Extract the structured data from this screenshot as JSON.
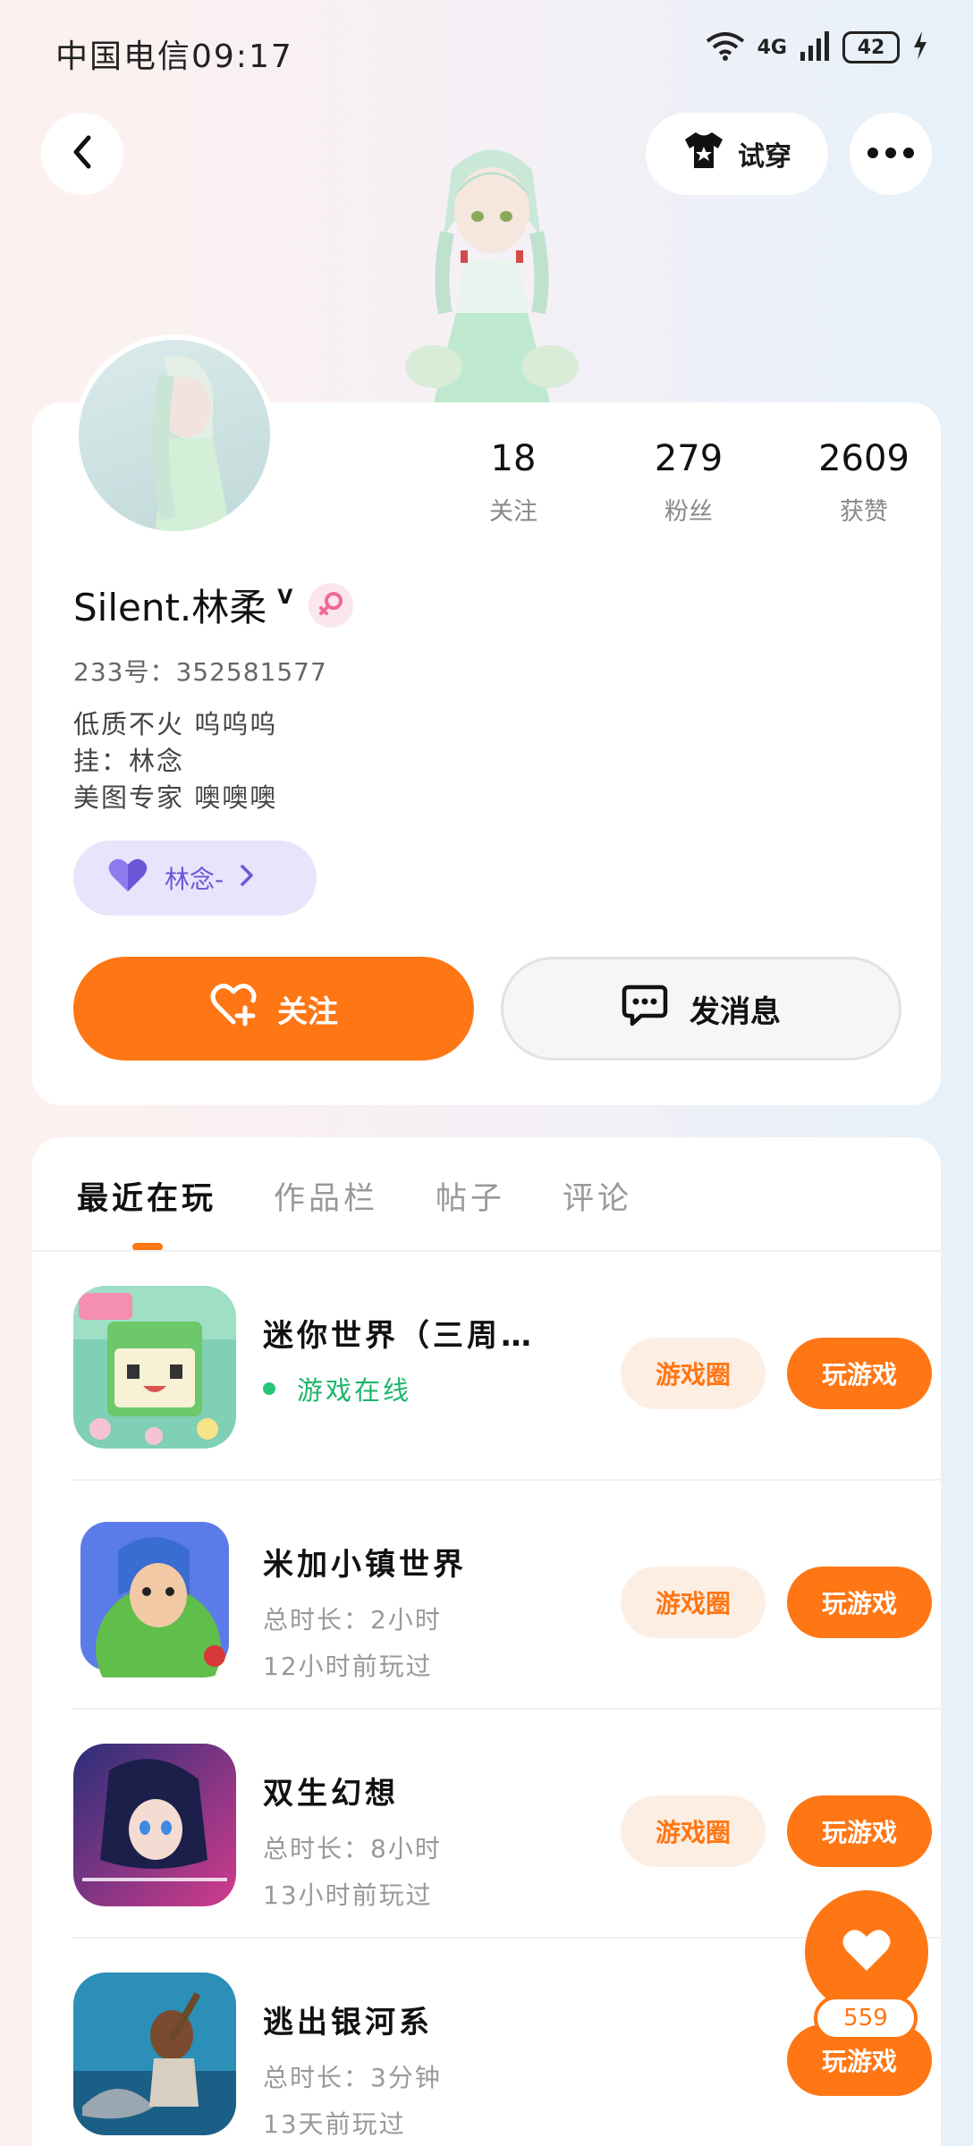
{
  "status_bar": {
    "carrier_time": "中国电信09:17",
    "network": "4G",
    "battery": "42"
  },
  "nav": {
    "tryon_label": "试穿"
  },
  "profile": {
    "stats": [
      {
        "value": "18",
        "label": "关注"
      },
      {
        "value": "279",
        "label": "粉丝"
      },
      {
        "value": "2609",
        "label": "获赞"
      }
    ],
    "username": "Silent.林柔",
    "vip_mark": "V",
    "user_id": "233号：352581577",
    "bio_lines": [
      "低质不火 呜呜呜",
      "挂：林念",
      "美图专家 噢噢噢"
    ],
    "fan_tag": "林念-",
    "follow_label": "关注",
    "message_label": "发消息"
  },
  "tabs": [
    "最近在玩",
    "作品栏",
    "帖子",
    "评论"
  ],
  "games": [
    {
      "name": "迷你世界（三周…",
      "status": "游戏在线",
      "circle_label": "游戏圈",
      "play_label": "玩游戏"
    },
    {
      "name": "米加小镇世界",
      "duration": "总时长：2小时",
      "last_played": "12小时前玩过",
      "circle_label": "游戏圈",
      "play_label": "玩游戏"
    },
    {
      "name": "双生幻想",
      "duration": "总时长：8小时",
      "last_played": "13小时前玩过",
      "circle_label": "游戏圈",
      "play_label": "玩游戏"
    },
    {
      "name": "逃出银河系",
      "duration": "总时长：3分钟",
      "last_played": "13天前玩过",
      "play_label": "玩游戏"
    }
  ],
  "float_like": {
    "count": "559"
  },
  "icons": {
    "back": "chevron-left-icon",
    "tryon": "tshirt-icon",
    "more": "more-dots-icon",
    "gender": "female-icon",
    "fan_tag": "heart-icon",
    "follow": "heart-plus-icon",
    "message": "chat-bubble-icon",
    "like": "heart-icon"
  },
  "colors": {
    "accent": "#ff7614",
    "online": "#1bb56b",
    "fan_tag_bg": "#e8e4fb",
    "fan_tag_text": "#6a57d8"
  }
}
